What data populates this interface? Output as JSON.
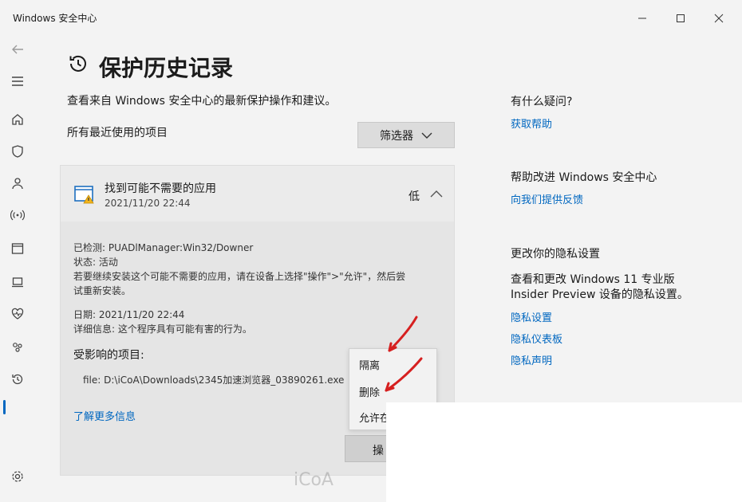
{
  "window": {
    "title": "Windows 安全中心"
  },
  "page": {
    "title": "保护历史记录",
    "subtitle": "查看来自 Windows 安全中心的最新保护操作和建议。",
    "section_label": "所有最近使用的项目",
    "filter_label": "筛选器"
  },
  "card": {
    "title": "找到可能不需要的应用",
    "datetime": "2021/11/20 22:44",
    "severity": "低",
    "detected": "已检测: PUADlManager:Win32/Downer",
    "status": "状态: 活动",
    "advice_line1": "若要继续安装这个可能不需要的应用，请在设备上选择\"操作\">\"允许\"，然后尝",
    "advice_line2": "试重新安装。",
    "date": "日期: 2021/11/20 22:44",
    "details": "详细信息: 这个程序具有可能有害的行为。",
    "affected_label": "受影响的项目:",
    "file": "file: D:\\iCoA\\Downloads\\2345加速浏览器_03890261.exe",
    "learn_more": "了解更多信息",
    "actions_label": "操"
  },
  "menu": {
    "items": [
      "隔离",
      "删除",
      "允许在"
    ]
  },
  "right": {
    "help_heading": "有什么疑问?",
    "help_link": "获取帮助",
    "improve_heading": "帮助改进 Windows 安全中心",
    "improve_link": "向我们提供反馈",
    "privacy_heading": "更改你的隐私设置",
    "privacy_text_line1": "查看和更改 Windows 11 专业版",
    "privacy_text_line2": "Insider Preview 设备的隐私设置。",
    "privacy_links": [
      "隐私设置",
      "隐私仪表板",
      "隐私声明"
    ]
  },
  "watermark": "iCoA",
  "colors": {
    "accent": "#0067c0",
    "annotation": "#d62020"
  }
}
